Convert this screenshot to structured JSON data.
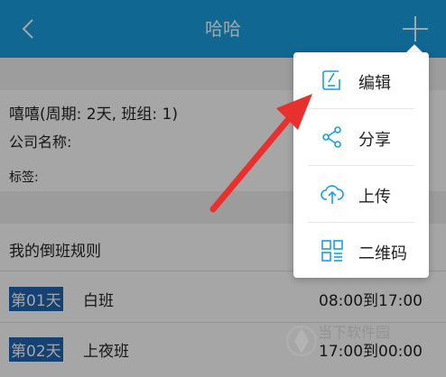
{
  "header": {
    "title": "哈哈"
  },
  "info": {
    "name_line": "嘻嘻(周期: 2天, 班组: 1)",
    "company_label": "公司名称:",
    "tag_label": "标签:"
  },
  "rules": {
    "title": "我的倒班规则",
    "rows": [
      {
        "day": "第01天",
        "shift": "白班",
        "time": "08:00到17:00"
      },
      {
        "day": "第02天",
        "shift": "上夜班",
        "time": "17:00到00:00"
      }
    ]
  },
  "menu": {
    "items": [
      {
        "label": "编辑",
        "icon": "edit-icon"
      },
      {
        "label": "分享",
        "icon": "share-icon"
      },
      {
        "label": "上传",
        "icon": "upload-icon"
      },
      {
        "label": "二维码",
        "icon": "qrcode-icon"
      }
    ]
  },
  "watermark": {
    "text": "当下软件园"
  },
  "colors": {
    "header": "#1a9ee0",
    "accent_icon": "#1a9ee0",
    "arrow": "#e8312f",
    "day_highlight": "#2166b0"
  }
}
